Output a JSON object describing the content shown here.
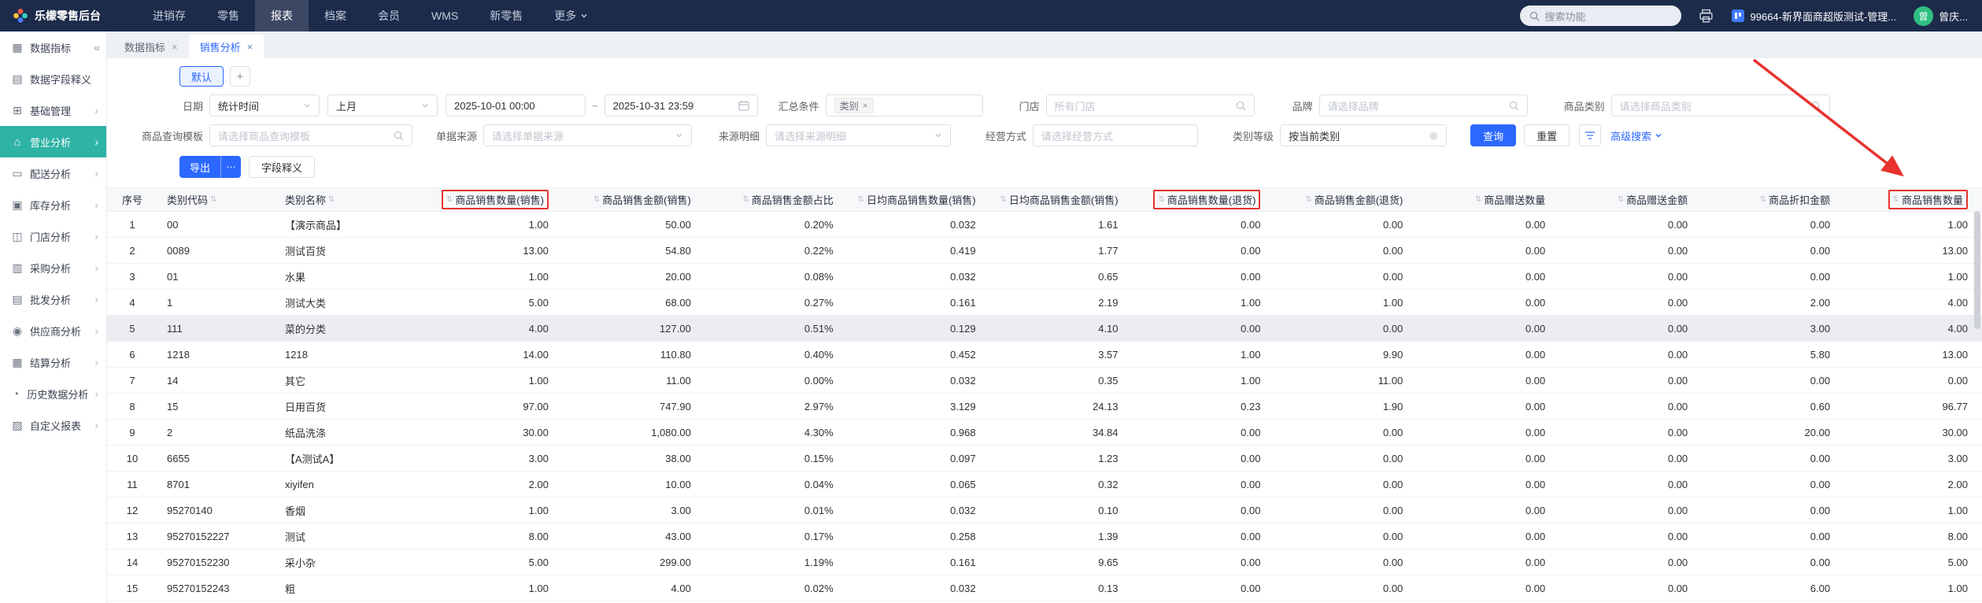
{
  "colors": {
    "accent": "#2c68ff",
    "sidebar_active": "#2eb3a5",
    "annotation": "#e8322e",
    "navbar_bg": "#1c2b4a"
  },
  "icons": {
    "sort": "⇅",
    "close": "×",
    "collapse": "«",
    "chevron_right": "›",
    "clear": "⊗",
    "plus": "+"
  },
  "navbar": {
    "brand": "乐檬零售后台",
    "menu_items": [
      "进销存",
      "零售",
      "报表",
      "档案",
      "会员",
      "WMS",
      "新零售",
      "更多"
    ],
    "active_item": "报表",
    "search_placeholder": "搜索功能",
    "store_name": "99664-新界面商超版测试-管理...",
    "user_name": "曾庆...",
    "avatar_text": "曾"
  },
  "sidebar": {
    "items": [
      {
        "label": "数据指标",
        "icon": "▦"
      },
      {
        "label": "数据字段释义",
        "icon": "▤"
      },
      {
        "label": "基础管理",
        "icon": "⊞"
      },
      {
        "label": "营业分析",
        "icon": "⌂"
      },
      {
        "label": "配送分析",
        "icon": "▭"
      },
      {
        "label": "库存分析",
        "icon": "▣"
      },
      {
        "label": "门店分析",
        "icon": "◫"
      },
      {
        "label": "采购分析",
        "icon": "▥"
      },
      {
        "label": "批发分析",
        "icon": "▤"
      },
      {
        "label": "供应商分析",
        "icon": "◉"
      },
      {
        "label": "结算分析",
        "icon": "▦"
      },
      {
        "label": "历史数据分析",
        "icon": "◔"
      },
      {
        "label": "自定义报表",
        "icon": "▧"
      }
    ],
    "active_item": "营业分析"
  },
  "tabs": [
    {
      "label": "数据指标"
    },
    {
      "label": "销售分析",
      "active": true
    }
  ],
  "filters": {
    "preset_label": "默认",
    "add_label": "+",
    "date_label": "日期",
    "stat_time": "统计时间",
    "period": "上月",
    "date_from": "2025-10-01 00:00",
    "date_separator": "~",
    "date_to": "2025-10-31 23:59",
    "summary_label": "汇总条件",
    "summary_tag": "类别",
    "store_label": "门店",
    "store_value": "所有门店",
    "brand_label": "品牌",
    "brand_placeholder": "请选择品牌",
    "category_label": "商品类别",
    "category_placeholder": "请选择商品类别",
    "template_label": "商品查询模板",
    "template_placeholder": "请选择商品查询模板",
    "source_label": "单据来源",
    "source_placeholder": "请选择单据来源",
    "source_detail_label": "来源明细",
    "source_detail_placeholder": "请选择来源明细",
    "mode_label": "经营方式",
    "mode_placeholder": "请选择经营方式",
    "level_label": "类别等级",
    "level_value": "按当前类别",
    "search_button": "查询",
    "reset_button": "重置",
    "advanced_search": "高级搜索"
  },
  "toolbar": {
    "export_label": "导出",
    "export_more": "⋯",
    "field_definition": "字段释义"
  },
  "table": {
    "columns": [
      {
        "label": "序号"
      },
      {
        "label": "类别代码",
        "sortable": true
      },
      {
        "label": "类别名称",
        "sortable": true
      },
      {
        "label": "商品销售数量(销售)",
        "sortable": true,
        "red_box": true
      },
      {
        "label": "商品销售金额(销售)",
        "sortable": true
      },
      {
        "label": "商品销售金额占比",
        "sortable": true
      },
      {
        "label": "日均商品销售数量(销售)",
        "sortable": true
      },
      {
        "label": "日均商品销售金额(销售)",
        "sortable": true
      },
      {
        "label": "商品销售数量(退货)",
        "sortable": true,
        "red_box": true
      },
      {
        "label": "商品销售金额(退货)",
        "sortable": true
      },
      {
        "label": "商品赠送数量",
        "sortable": true
      },
      {
        "label": "商品赠送金额",
        "sortable": true
      },
      {
        "label": "商品折扣金额",
        "sortable": true
      },
      {
        "label": "商品销售数量",
        "sortable": true,
        "red_box": true
      }
    ],
    "rows": [
      {
        "cells": [
          "1",
          "00",
          "【演示商品】",
          "1.00",
          "50.00",
          "0.20%",
          "0.032",
          "1.61",
          "0.00",
          "0.00",
          "0.00",
          "0.00",
          "0.00",
          "1.00"
        ]
      },
      {
        "cells": [
          "2",
          "0089",
          "测试百货",
          "13.00",
          "54.80",
          "0.22%",
          "0.419",
          "1.77",
          "0.00",
          "0.00",
          "0.00",
          "0.00",
          "0.00",
          "13.00"
        ]
      },
      {
        "cells": [
          "3",
          "01",
          "水果",
          "1.00",
          "20.00",
          "0.08%",
          "0.032",
          "0.65",
          "0.00",
          "0.00",
          "0.00",
          "0.00",
          "0.00",
          "1.00"
        ]
      },
      {
        "cells": [
          "4",
          "1",
          "测试大类",
          "5.00",
          "68.00",
          "0.27%",
          "0.161",
          "2.19",
          "1.00",
          "1.00",
          "0.00",
          "0.00",
          "2.00",
          "4.00"
        ]
      },
      {
        "cells": [
          "5",
          "111",
          "菜的分类",
          "4.00",
          "127.00",
          "0.51%",
          "0.129",
          "4.10",
          "0.00",
          "0.00",
          "0.00",
          "0.00",
          "3.00",
          "4.00"
        ],
        "highlighted": true
      },
      {
        "cells": [
          "6",
          "1218",
          "1218",
          "14.00",
          "110.80",
          "0.40%",
          "0.452",
          "3.57",
          "1.00",
          "9.90",
          "0.00",
          "0.00",
          "5.80",
          "13.00"
        ]
      },
      {
        "cells": [
          "7",
          "14",
          "其它",
          "1.00",
          "11.00",
          "0.00%",
          "0.032",
          "0.35",
          "1.00",
          "11.00",
          "0.00",
          "0.00",
          "0.00",
          "0.00"
        ]
      },
      {
        "cells": [
          "8",
          "15",
          "日用百货",
          "97.00",
          "747.90",
          "2.97%",
          "3.129",
          "24.13",
          "0.23",
          "1.90",
          "0.00",
          "0.00",
          "0.60",
          "96.77"
        ]
      },
      {
        "cells": [
          "9",
          "2",
          "纸品洗涤",
          "30.00",
          "1,080.00",
          "4.30%",
          "0.968",
          "34.84",
          "0.00",
          "0.00",
          "0.00",
          "0.00",
          "20.00",
          "30.00"
        ]
      },
      {
        "cells": [
          "10",
          "6655",
          "【A测试A】",
          "3.00",
          "38.00",
          "0.15%",
          "0.097",
          "1.23",
          "0.00",
          "0.00",
          "0.00",
          "0.00",
          "0.00",
          "3.00"
        ]
      },
      {
        "cells": [
          "11",
          "8701",
          "xiyifen",
          "2.00",
          "10.00",
          "0.04%",
          "0.065",
          "0.32",
          "0.00",
          "0.00",
          "0.00",
          "0.00",
          "0.00",
          "2.00"
        ]
      },
      {
        "cells": [
          "12",
          "95270140",
          "香烟",
          "1.00",
          "3.00",
          "0.01%",
          "0.032",
          "0.10",
          "0.00",
          "0.00",
          "0.00",
          "0.00",
          "0.00",
          "1.00"
        ]
      },
      {
        "cells": [
          "13",
          "95270152227",
          "测试",
          "8.00",
          "43.00",
          "0.17%",
          "0.258",
          "1.39",
          "0.00",
          "0.00",
          "0.00",
          "0.00",
          "0.00",
          "8.00"
        ]
      },
      {
        "cells": [
          "14",
          "95270152230",
          "采小杂",
          "5.00",
          "299.00",
          "1.19%",
          "0.161",
          "9.65",
          "0.00",
          "0.00",
          "0.00",
          "0.00",
          "0.00",
          "5.00"
        ]
      },
      {
        "cells": [
          "15",
          "95270152243",
          "粗",
          "1.00",
          "4.00",
          "0.02%",
          "0.032",
          "0.13",
          "0.00",
          "0.00",
          "0.00",
          "0.00",
          "6.00",
          "1.00"
        ]
      }
    ]
  }
}
